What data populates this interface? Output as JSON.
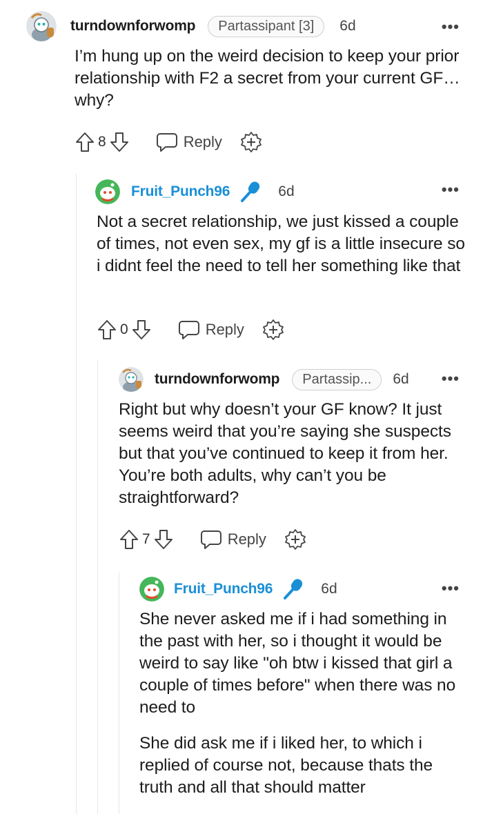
{
  "comments": [
    {
      "username": "turndownforwomp",
      "flair": "Partassipant [3]",
      "age": "6d",
      "text": [
        "I’m hung up on the weird decision to keep your prior relationship with F2 a secret from your current GF…why?"
      ],
      "score": "8",
      "reply_label": "Reply"
    },
    {
      "username": "Fruit_Punch96",
      "age": "6d",
      "text": [
        "Not a secret relationship, we just kissed a couple of times, not even sex, my gf is a little insecure so i didnt feel the need to tell her something like that"
      ],
      "score": "0",
      "reply_label": "Reply"
    },
    {
      "username": "turndownforwomp",
      "flair": "Partassip...",
      "age": "6d",
      "text": [
        "Right but why doesn’t your GF know? It just seems weird that you’re saying she suspects but that you’ve continued to keep it from her. You’re both adults, why can’t you be straightforward?"
      ],
      "score": "7",
      "reply_label": "Reply"
    },
    {
      "username": "Fruit_Punch96",
      "age": "6d",
      "text": [
        "She never asked me if i had something in the past with her, so i thought it would be weird to say like \"oh btw i kissed that girl a couple of times before\" when there was no need to",
        "She did ask me if i liked her, to which i replied of course not, because thats the truth and all that should matter"
      ]
    }
  ],
  "more_label": "•••",
  "colors": {
    "op_username": "#1a8fd6",
    "thread_line": "#e6e6e6",
    "mic": "#1a8fd6"
  },
  "icons": [
    "snoo-avatar-icon",
    "microphone-icon",
    "upvote-icon",
    "downvote-icon",
    "reply-icon",
    "award-icon",
    "more-icon"
  ]
}
